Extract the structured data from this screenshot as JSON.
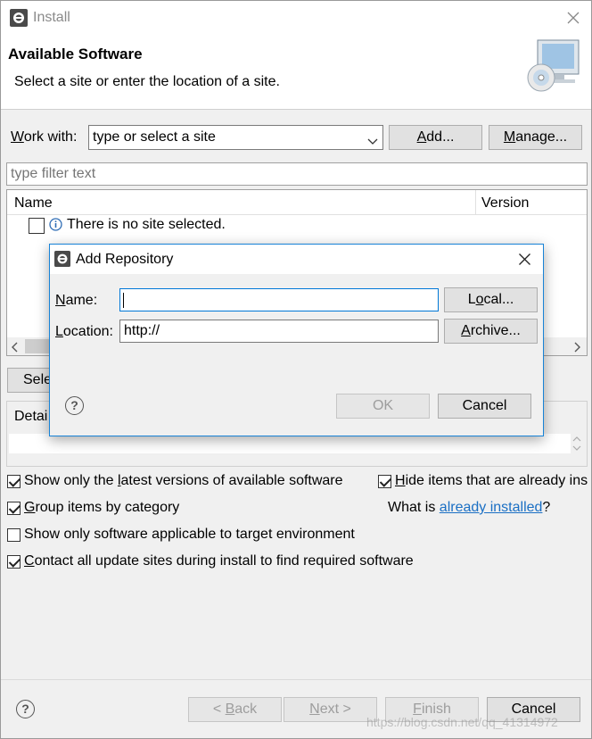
{
  "window": {
    "title": "Install"
  },
  "banner": {
    "title": "Available Software",
    "subtitle": "Select a site or enter the location of a site."
  },
  "work_with": {
    "label_mnemonic": "W",
    "label_rest": "ork with:",
    "combo_value": "type or select a site",
    "add_mnemonic": "A",
    "add_rest": "dd...",
    "manage_mnemonic": "M",
    "manage_rest": "anage..."
  },
  "filter": {
    "placeholder": "type filter text"
  },
  "table": {
    "columns": [
      "Name",
      "Version"
    ],
    "rows": [
      {
        "text": "There is no site selected."
      }
    ]
  },
  "partial": {
    "select_prefix": "Sele",
    "details_prefix": "Detai"
  },
  "options": {
    "show_latest_pre": "Show only the ",
    "show_latest_mn": "l",
    "show_latest_post": "atest versions of available software",
    "hide_installed_mn": "H",
    "hide_installed_post": "ide items that are already ins",
    "group_mn": "G",
    "group_post": "roup items by category",
    "what_is_pre": "What is ",
    "already_installed_link": "already installed",
    "what_is_post": "?",
    "applicable": "Show only software applicable to target environment",
    "contact_mn": "C",
    "contact_post": "ontact all update sites during install to find required software"
  },
  "footer": {
    "back_pre": "< ",
    "back_mn": "B",
    "back_post": "ack",
    "next_mn": "N",
    "next_post": "ext >",
    "finish_mn": "F",
    "finish_post": "inish",
    "cancel": "Cancel"
  },
  "dialog": {
    "title": "Add Repository",
    "name_mn": "N",
    "name_post": "ame:",
    "name_value": "",
    "location_mn": "L",
    "location_post": "ocation:",
    "location_value": "http://",
    "local_pre": "L",
    "local_mn": "o",
    "local_post": "cal...",
    "archive_mn": "A",
    "archive_post": "rchive...",
    "ok": "OK",
    "cancel": "Cancel"
  },
  "watermark": "https://blog.csdn.net/qq_41314972"
}
